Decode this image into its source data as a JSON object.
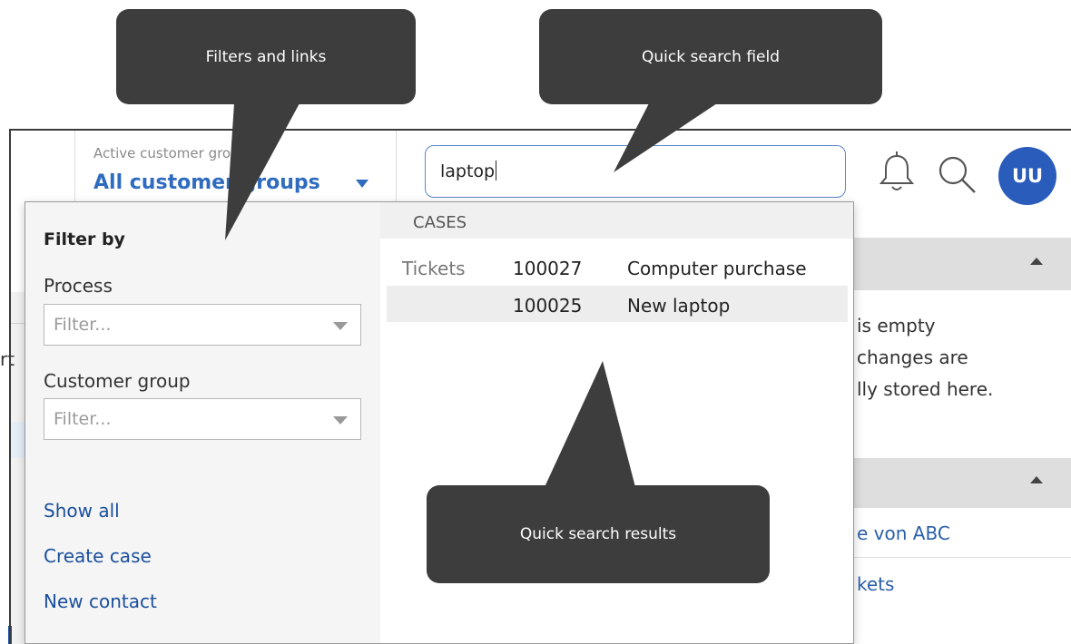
{
  "header": {
    "group_label": "Active customer group",
    "group_value": "All customer groups",
    "search_value": "laptop",
    "avatar_initials": "UU"
  },
  "filter_panel": {
    "title": "Filter by",
    "process_label": "Process",
    "process_placeholder": "Filter...",
    "customer_group_label": "Customer group",
    "customer_group_placeholder": "Filter...",
    "links": [
      "Show all",
      "Create case",
      "New contact"
    ]
  },
  "results": {
    "section": "CASES",
    "category": "Tickets",
    "rows": [
      {
        "id": "100027",
        "title": "Computer purchase"
      },
      {
        "id": "100025",
        "title": "New laptop"
      }
    ]
  },
  "background": {
    "empty_lines": [
      "is empty",
      "changes are",
      "lly stored here."
    ],
    "link1": "e von ABC",
    "link2": "kets",
    "left_fragment": "rt"
  },
  "callouts": {
    "filters": "Filters and links",
    "search_field": "Quick search field",
    "search_results": "Quick search results"
  },
  "colors": {
    "accent": "#2f6bbf",
    "avatar": "#2a5cbb",
    "callout": "#3d3d3d"
  }
}
